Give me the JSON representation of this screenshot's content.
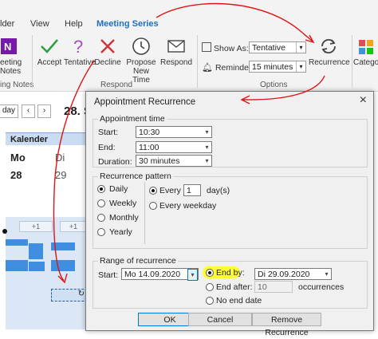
{
  "tabs": [
    {
      "label": "lder"
    },
    {
      "label": "View"
    },
    {
      "label": "Help"
    },
    {
      "label": "Meeting Series"
    }
  ],
  "ribbon": {
    "onenote_label1": "eeting",
    "onenote_label2": "Notes",
    "onenote_group": "ing Notes",
    "accept": "Accept",
    "tentative": "Tentative",
    "decline": "Decline",
    "propose": "Propose",
    "propose2": "New Time",
    "respond": "Respond",
    "respond_group": "Respond",
    "show_as_label": "Show As:",
    "show_as_value": "Tentative",
    "reminder_label": "Reminder:",
    "reminder_value": "15 minutes",
    "options_group": "Options",
    "recurrence": "Recurrence",
    "categorize": "Catego"
  },
  "calendar": {
    "today": "day",
    "date_title": "28. S",
    "header": "Kalender",
    "days": [
      {
        "name": "Mo",
        "num": "28"
      },
      {
        "name": "Di",
        "num": "29"
      }
    ],
    "more1": "+1",
    "more2": "+1"
  },
  "dialog": {
    "title": "Appointment Recurrence",
    "close": "×",
    "appointment_time": {
      "legend": "Appointment time",
      "start_label": "Start:",
      "start_value": "10:30",
      "end_label": "End:",
      "end_value": "11:00",
      "duration_label": "Duration:",
      "duration_value": "30 minutes"
    },
    "pattern": {
      "legend": "Recurrence pattern",
      "options": [
        "Daily",
        "Weekly",
        "Monthly",
        "Yearly"
      ],
      "selected": "Daily",
      "every_label": "Every",
      "every_value": "1",
      "every_unit": "day(s)",
      "every_weekday": "Every weekday"
    },
    "range": {
      "legend": "Range of recurrence",
      "start_label": "Start:",
      "start_value": "Mo 14.09.2020",
      "end_by_label": "End by:",
      "end_by_value": "Di 29.09.2020",
      "end_after_label": "End after:",
      "end_after_value": "10",
      "occurrences": "occurrences",
      "no_end": "No end date"
    },
    "buttons": {
      "ok": "OK",
      "cancel": "Cancel",
      "remove": "Remove Recurrence"
    }
  },
  "colors": {
    "accent": "#1f6fbf",
    "annotation": "#e01414",
    "highlight": "#ffff33"
  }
}
